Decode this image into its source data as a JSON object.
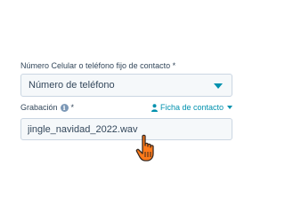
{
  "phone_field": {
    "label": "Número Celular o teléfono fijo de contacto *",
    "selected_value": "Número de teléfono"
  },
  "recording_field": {
    "label": "Grabación",
    "required_marker": "*",
    "info_icon": "info-icon",
    "contact_link_label": "Ficha de contacto",
    "contact_link_icon": "person-icon",
    "value": "jingle_navidad_2022.wav"
  },
  "cursor": {
    "icon": "pointer-hand-icon"
  },
  "colors": {
    "accent": "#0091ae",
    "text": "#33475b",
    "input_bg": "#f5f8fa",
    "input_border": "#cbd6e2",
    "cursor_fill": "#ff7a1a"
  }
}
